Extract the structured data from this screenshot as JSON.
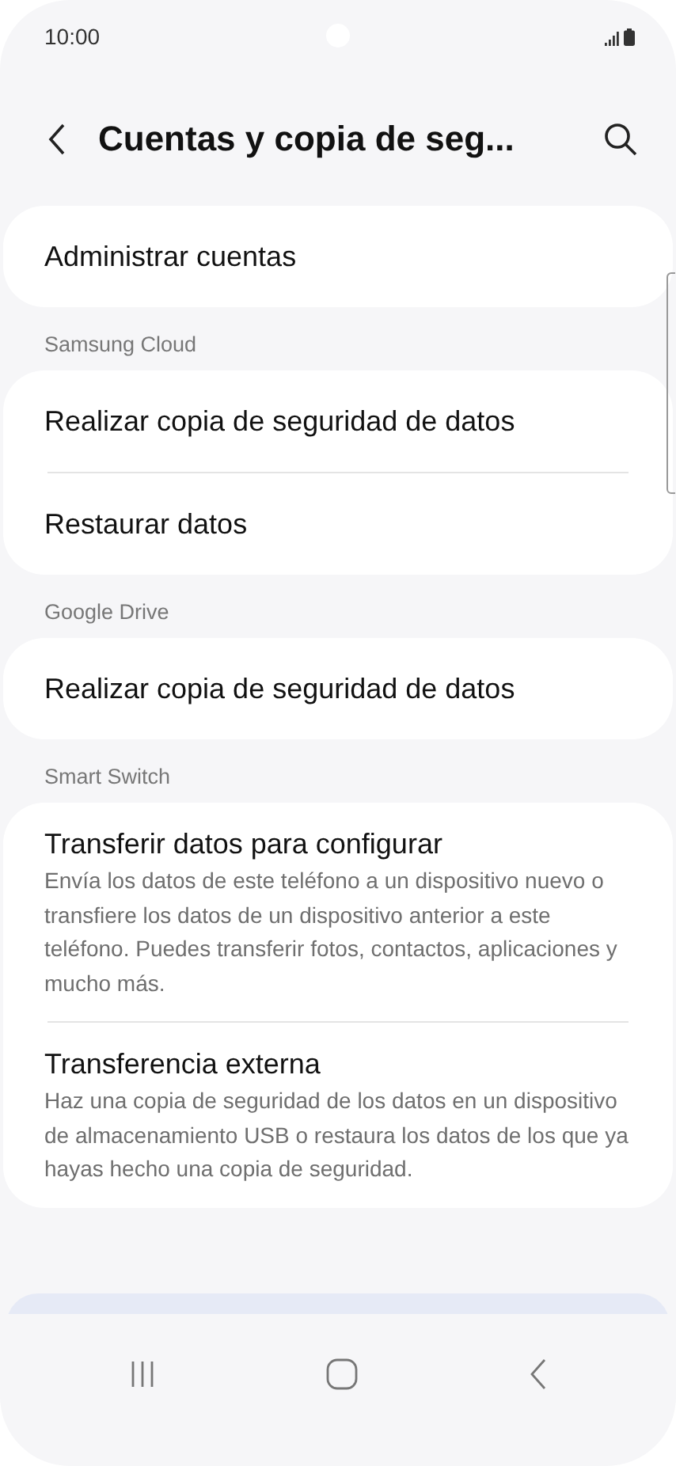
{
  "status_bar": {
    "time": "10:00"
  },
  "header": {
    "title": "Cuentas y copia de seg..."
  },
  "sections": [
    {
      "items": [
        {
          "title": "Administrar cuentas"
        }
      ]
    },
    {
      "header": "Samsung Cloud",
      "items": [
        {
          "title": "Realizar copia de seguridad de datos"
        },
        {
          "title": "Restaurar datos"
        }
      ]
    },
    {
      "header": "Google Drive",
      "items": [
        {
          "title": "Realizar copia de seguridad de datos"
        }
      ]
    },
    {
      "header": "Smart Switch",
      "items": [
        {
          "title": "Transferir datos para configurar",
          "summary": "Envía los datos de este teléfono a un dispositivo nuevo o transfiere los datos de un dispositivo anterior a este teléfono. Puedes transferir fotos, contactos, aplicaciones y mucho más."
        },
        {
          "title": "Transferencia externa",
          "summary": "Haz una copia de seguridad de los datos en un dispositivo de almacenamiento USB o restaura los datos de los que ya hayas hecho una copia de seguridad."
        }
      ]
    }
  ]
}
